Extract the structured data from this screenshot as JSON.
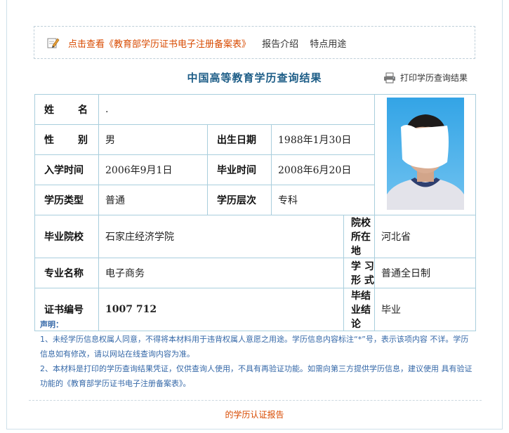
{
  "top_links": {
    "verify_link": "点击查看《教育部学历证书电子注册备案表》",
    "report_intro": "报告介绍",
    "features": "特点用途"
  },
  "page_title": "中国高等教育学历查询结果",
  "print_label": "打印学历查询结果",
  "record": {
    "name_label_1": "姓",
    "name_label_2": "名",
    "name_value": ".",
    "gender_label_1": "性",
    "gender_label_2": "别",
    "gender_value": "男",
    "birth_label": "出生日期",
    "birth_value": "1988年1月30日",
    "enroll_label": "入学时间",
    "enroll_value": "2006年9月1日",
    "graduate_label": "毕业时间",
    "graduate_value": "2008年6月20日",
    "type_label": "学历类型",
    "type_value": "普通",
    "level_label": "学历层次",
    "level_value": "专科",
    "school_label": "毕业院校",
    "school_value": "石家庄经济学院",
    "location_label": "院校所在地",
    "location_value": "河北省",
    "major_label": "专业名称",
    "major_value": "电子商务",
    "form_label": "学 习 形 式",
    "form_value": "普通全日制",
    "cert_label": "证书编号",
    "cert_value": "1007 712",
    "conclusion_label": "毕结业结论",
    "conclusion_value": "毕业"
  },
  "declaration": {
    "heading": "声明：",
    "item1": "1、未经学历信息权属人同意，不得将本材料用于违背权属人意愿之用途。学历信息内容标注“*”号，表示该项内容 不详。学历信息如有修改，请以网站在线查询内容为准。",
    "item2": "2、本材料是打印的学历查询结果凭证，仅供查询人使用，不具有再验证功能。如需向第三方提供学历信息，建议使用 具有验证功能的《教育部学历证书电子注册备案表》。"
  },
  "footer_text": "的学历认证报告",
  "colors": {
    "accent": "#d84a00",
    "title": "#1d5d87",
    "border": "#a9cedd",
    "decl": "#3568a8"
  }
}
